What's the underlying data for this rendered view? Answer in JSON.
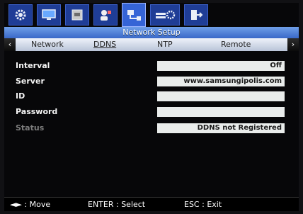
{
  "title": "Network Setup",
  "icon_tabs": [
    {
      "icon": "gear-icon"
    },
    {
      "icon": "monitor-icon"
    },
    {
      "icon": "hdd-icon"
    },
    {
      "icon": "user-icon"
    },
    {
      "icon": "network-icon"
    },
    {
      "icon": "system-settings-icon"
    },
    {
      "icon": "exit-icon"
    }
  ],
  "subtabs": {
    "network": "Network",
    "ddns": "DDNS",
    "ntp": "NTP",
    "remote": "Remote",
    "active": "DDNS"
  },
  "nav": {
    "left_arrow": "‹",
    "right_arrow": "›"
  },
  "fields": {
    "interval": {
      "label": "Interval",
      "value": "Off"
    },
    "server": {
      "label": "Server",
      "value": "www.samsungipolis.com"
    },
    "id": {
      "label": "ID",
      "value": ""
    },
    "password": {
      "label": "Password",
      "value": ""
    },
    "status": {
      "label": "Status",
      "value": "DDNS not Registered"
    }
  },
  "footer": {
    "move": "◄► : Move",
    "select": "ENTER : Select",
    "exit": "ESC : Exit"
  },
  "colors": {
    "accent": "#3564d6",
    "title_bar": "#5f8fe0",
    "field_bg": "#e9eceb",
    "disabled_text": "#7d7d7d"
  }
}
